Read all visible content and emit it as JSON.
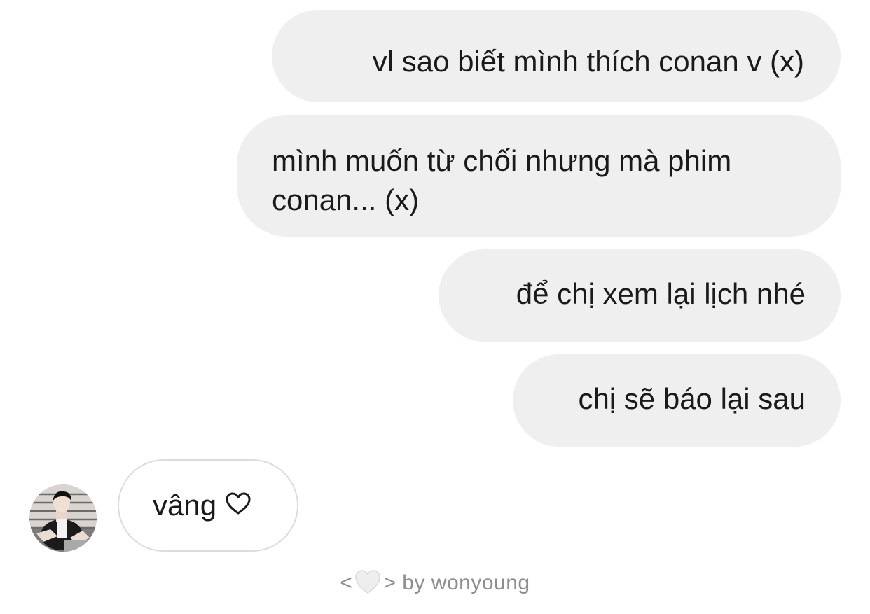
{
  "messages": [
    {
      "sender": "self",
      "text": "vl sao biết mình thích conan v (x)"
    },
    {
      "sender": "self",
      "text_line1": "mình muốn từ chối nhưng mà phim",
      "text_line2": "conan... (x)"
    },
    {
      "sender": "self",
      "text": "để chị xem lại lịch nhé"
    },
    {
      "sender": "self",
      "text": "chị sẽ báo lại sau"
    },
    {
      "sender": "other",
      "text": "vâng",
      "icon": "heart-outline-icon"
    }
  ],
  "avatar": {
    "icon": "profile-photo"
  },
  "credit": {
    "prefix": "<",
    "icon": "white-heart-icon",
    "suffix": "> by wonyoung"
  },
  "colors": {
    "self_bubble": "#efefef",
    "other_bubble_border": "#dcdcdc",
    "credit_text": "#8e8e8e"
  }
}
